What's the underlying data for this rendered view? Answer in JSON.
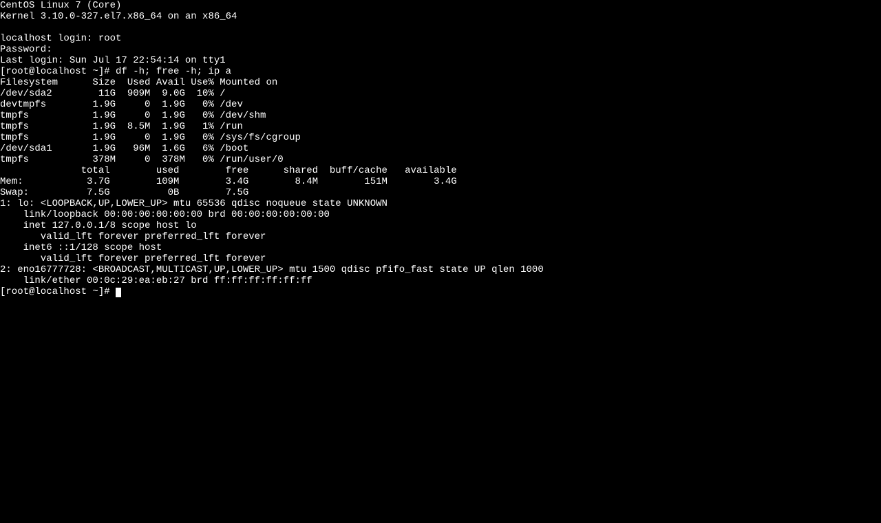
{
  "banner": {
    "line1": "CentOS Linux 7 (Core)",
    "line2": "Kernel 3.10.0-327.el7.x86_64 on an x86_64"
  },
  "login": {
    "prompt": "localhost login: ",
    "user": "root",
    "password_label": "Password:",
    "last_login": "Last login: Sun Jul 17 22:54:14 on tty1"
  },
  "shell": {
    "prompt": "[root@localhost ~]# ",
    "command": "df -h; free -h; ip a"
  },
  "df": {
    "header": "Filesystem      Size  Used Avail Use% Mounted on",
    "rows": [
      "/dev/sda2        11G  909M  9.0G  10% /",
      "devtmpfs        1.9G     0  1.9G   0% /dev",
      "tmpfs           1.9G     0  1.9G   0% /dev/shm",
      "tmpfs           1.9G  8.5M  1.9G   1% /run",
      "tmpfs           1.9G     0  1.9G   0% /sys/fs/cgroup",
      "/dev/sda1       1.9G   96M  1.6G   6% /boot",
      "tmpfs           378M     0  378M   0% /run/user/0"
    ]
  },
  "free": {
    "header": "              total        used        free      shared  buff/cache   available",
    "mem": "Mem:           3.7G        109M        3.4G        8.4M        151M        3.4G",
    "swap": "Swap:          7.5G          0B        7.5G"
  },
  "ip": {
    "l1": "1: lo: <LOOPBACK,UP,LOWER_UP> mtu 65536 qdisc noqueue state UNKNOWN ",
    "l2": "    link/loopback 00:00:00:00:00:00 brd 00:00:00:00:00:00",
    "l3": "    inet 127.0.0.1/8 scope host lo",
    "l4": "       valid_lft forever preferred_lft forever",
    "l5": "    inet6 ::1/128 scope host ",
    "l6": "       valid_lft forever preferred_lft forever",
    "l7": "2: eno16777728: <BROADCAST,MULTICAST,UP,LOWER_UP> mtu 1500 qdisc pfifo_fast state UP qlen 1000",
    "l8": "    link/ether 00:0c:29:ea:eb:27 brd ff:ff:ff:ff:ff:ff"
  },
  "trailing_prompt": "[root@localhost ~]# "
}
